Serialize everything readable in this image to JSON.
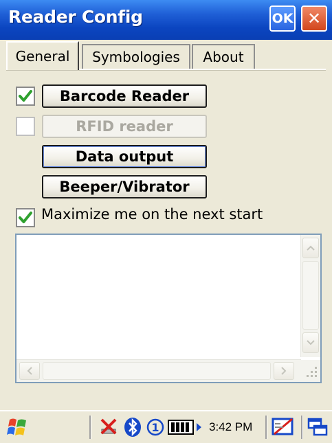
{
  "window": {
    "title": "Reader Config",
    "ok_label": "OK",
    "close_glyph": "✕"
  },
  "tabs": [
    {
      "label": "General",
      "active": true
    },
    {
      "label": "Symbologies",
      "active": false
    },
    {
      "label": "About",
      "active": false
    }
  ],
  "general": {
    "barcode_reader": {
      "label": "Barcode Reader",
      "checked": true,
      "enabled": true
    },
    "rfid_reader": {
      "label": "RFID reader",
      "checked": false,
      "enabled": false
    },
    "data_output_label": "Data output",
    "beeper_label": "Beeper/Vibrator",
    "maximize": {
      "label": "Maximize me on the next start",
      "checked": true
    },
    "log_text": ""
  },
  "taskbar": {
    "time": "3:42 PM",
    "icons": [
      "windows-start-icon",
      "network-icon",
      "bluetooth-icon",
      "info-icon",
      "battery-icon",
      "display-off-icon",
      "switch-windows-icon"
    ]
  },
  "colors": {
    "title_bar": "#0b45c0",
    "check_green": "#2fa12f",
    "background": "#ece9d8"
  }
}
